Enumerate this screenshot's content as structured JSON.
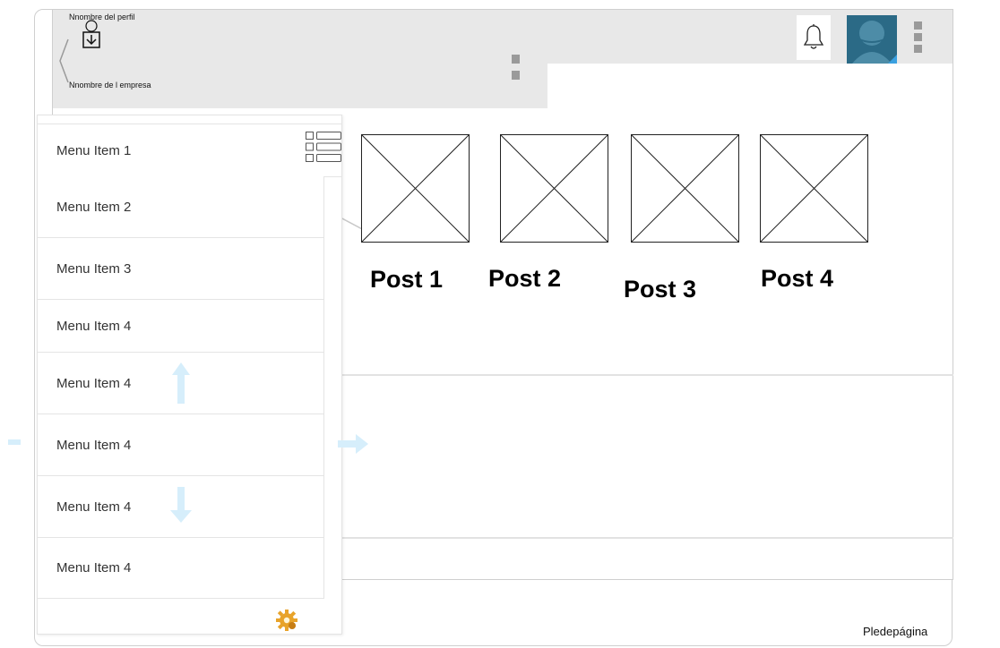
{
  "header": {
    "profile_name": "Nnombre del perfil",
    "company_name": "Nnombre de l empresa"
  },
  "icons": {
    "back": "chevron-left-icon",
    "profile": "user-download-icon",
    "notifications": "bell-icon",
    "avatar": "avatar-icon",
    "more": "kebab-menu-icon",
    "view_toggle": "list-view-icon",
    "settings": "gear-icon"
  },
  "colors": {
    "header_bg": "#e8e8e8",
    "avatar_bg": "#2b6a86",
    "avatar_accent": "#3aa0e0",
    "arrow_hint": "#d6eefb",
    "gear": "#e8a32a"
  },
  "sidebar": {
    "items": [
      {
        "label": "Menu Item 1"
      },
      {
        "label": "Menu Item 2"
      },
      {
        "label": "Menu Item 3"
      },
      {
        "label": "Menu Item 4"
      },
      {
        "label": "Menu Item 4"
      },
      {
        "label": "Menu Item 4"
      },
      {
        "label": "Menu Item 4"
      },
      {
        "label": "Menu Item 4"
      }
    ]
  },
  "posts": [
    {
      "title": "Post 1"
    },
    {
      "title": "Post 2"
    },
    {
      "title": "Post 3"
    },
    {
      "title": "Post 4"
    }
  ],
  "footer": {
    "text": "Pledepágina"
  }
}
